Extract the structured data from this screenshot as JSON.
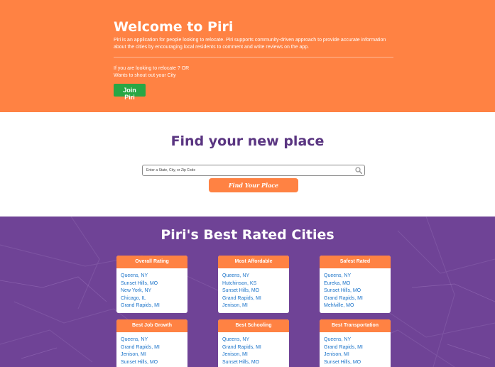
{
  "hero": {
    "title": "Welcome to Piri",
    "description": "Piri is an application for people looking to relocate. Piri supports community-driven approach to provide accurate information about the cities by encouraging local residents to comment and write reviews on the app.",
    "question_line1": "If you are looking to relocate ? OR",
    "question_line2": "Wants to shout out your City",
    "join_label": "Join Piri"
  },
  "find": {
    "title": "Find your new place",
    "search_placeholder": "Enter a State, City, or Zip Code",
    "button_label": "Find Your Place"
  },
  "cities": {
    "title": "Piri's Best Rated Cities",
    "cards": [
      {
        "heading": "Overall Rating",
        "items": [
          "Queens, NY",
          "Sunset Hills, MO",
          "New York, NY",
          "Chicago, IL",
          "Grand Rapids, MI"
        ]
      },
      {
        "heading": "Most Affordable",
        "items": [
          "Queens, NY",
          "Hutchinson, KS",
          "Sunset Hills, MO",
          "Grand Rapids, MI",
          "Jenison, MI"
        ]
      },
      {
        "heading": "Safest Rated",
        "items": [
          "Queens, NY",
          "Eureka, MO",
          "Sunset Hills, MO",
          "Grand Rapids, MI",
          "Mehlville, MO"
        ]
      },
      {
        "heading": "Best Job Growth",
        "items": [
          "Queens, NY",
          "Grand Rapids, MI",
          "Jenison, MI",
          "Sunset Hills, MO"
        ]
      },
      {
        "heading": "Best Schooling",
        "items": [
          "Queens, NY",
          "Grand Rapids, MI",
          "Jenison, MI",
          "Sunset Hills, MO"
        ]
      },
      {
        "heading": "Best Transportation",
        "items": [
          "Queens, NY",
          "Grand Rapids, MI",
          "Jenison, MI",
          "Sunset Hills, MO"
        ]
      }
    ]
  },
  "colors": {
    "orange": "#ff8243",
    "purple": "#6f4396",
    "title_purple": "#5a3581",
    "green": "#28a745",
    "link_blue": "#1a73c9"
  }
}
